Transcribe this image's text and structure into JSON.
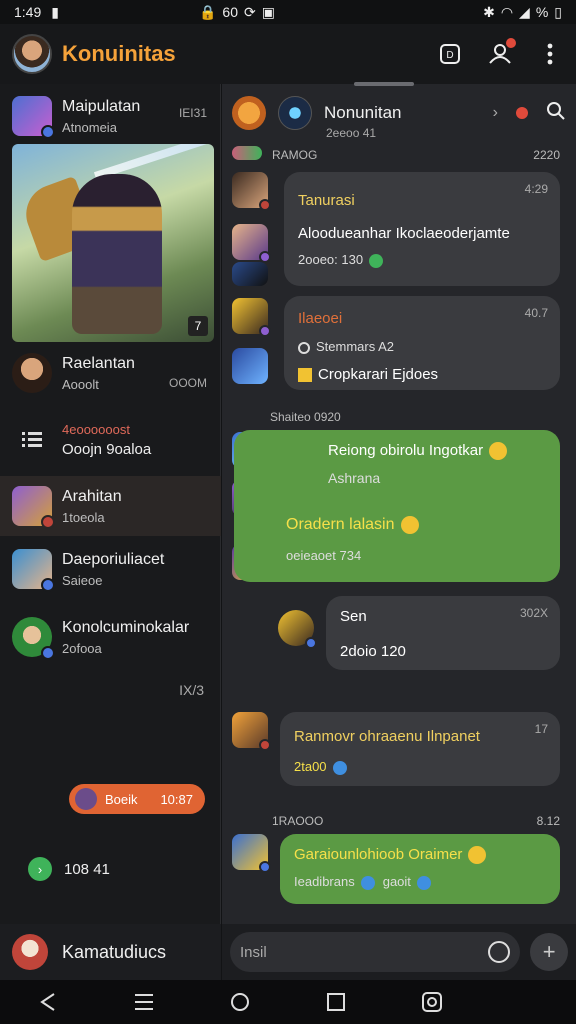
{
  "status": {
    "time": "1:49",
    "mid": "60",
    "battery": "%"
  },
  "app": {
    "title": "Konuinitas"
  },
  "sidebar": {
    "items": [
      {
        "name": "Maipulatan",
        "sub": "Atnomeia",
        "meta": "IEI31"
      },
      {
        "name": "Raelantan",
        "sub": "Aooolt",
        "meta": "OOOM"
      },
      {
        "name": "4eoooooost",
        "sub": "Ooojn 9oaloa"
      },
      {
        "name": "Arahitan",
        "sub": "1toeola"
      },
      {
        "name": "Daeporiuliacet",
        "sub": "Saieoe"
      },
      {
        "name": "Konolcuminokalar",
        "sub": "2ofooa"
      }
    ],
    "corner_label": "IX/3",
    "pill": {
      "label": "Boeik",
      "num": "10:87"
    },
    "bottom_entry": "108 41",
    "footer_name": "Kamatudiucs",
    "hero_corner": "7"
  },
  "chat": {
    "title": "Nonunitan",
    "subtitle": "2eeoo 41",
    "messages": [
      {
        "date": "RAMOG",
        "date_right": "2220"
      },
      {
        "title": "Tanurasi",
        "time": "4:29",
        "line1": "Aloodueanhar Ikoclaeoderjamte",
        "line2": "2ooeo: 130"
      },
      {
        "title": "Ilaeoei",
        "time": "40.7",
        "line1": "Stemmars A2",
        "line2": "Cropkarari Ejdoes"
      },
      {
        "date": "Shaiteo 0920"
      },
      {
        "title": "Reiong obirolu Ingotkar",
        "line1": "Ashrana",
        "line2": "Oradern lalasin",
        "line3": "oeieaoet 734"
      },
      {
        "title": "Sen",
        "time": "302X",
        "line1": "2doio 120"
      },
      {
        "title": "Ranmovr ohraaenu Ilnpanet",
        "time": "17",
        "line1": "2ta00"
      },
      {
        "date": "1RAOOO",
        "date_right": "8.12"
      },
      {
        "title": "Garaiounlohioob Oraimer",
        "line1": "Ieadibrans",
        "line2": "gaoit"
      }
    ]
  },
  "composer": {
    "placeholder": "Insil"
  }
}
